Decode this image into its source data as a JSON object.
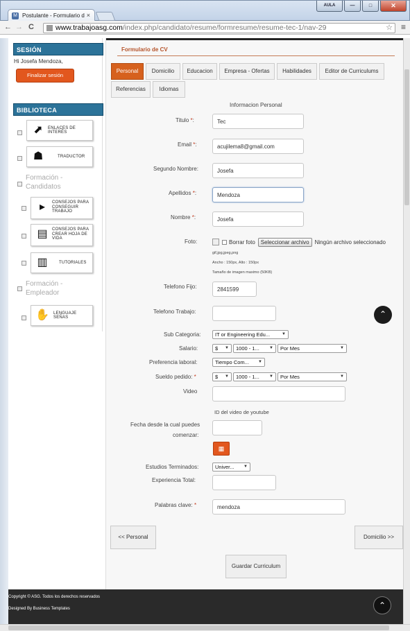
{
  "browser": {
    "tab_title": "Postulante - Formulario d",
    "tab_close": "×",
    "window_buttons": {
      "user": "AULA",
      "minimize": "—",
      "maximize": "□",
      "close": "✕"
    },
    "url_host": "www.trabajoasg.com",
    "url_path": "/index.php/candidato/resume/formresume/resume-tec-1/nav-29",
    "nav_back": "←",
    "nav_forward": "→",
    "nav_reload": "C",
    "star": "☆",
    "menu": "≡"
  },
  "sidebar": {
    "session_title": "SESIÓN",
    "greeting": "Hi Josefa Mendoza,",
    "logout_label": "Finalizar sesión",
    "library_title": "BIBLIOTECA",
    "items": [
      {
        "label": "ENLACES DE INTERÉS",
        "icon": "external-link-icon"
      },
      {
        "label": "TRADUCTOR",
        "icon": "translator-icon"
      },
      {
        "label": "CONSEJOS PARA CONSEGUIR TRABAJO",
        "icon": "presenter-icon"
      },
      {
        "label": "CONSEJOS PARA CREAR HOJA DE VIDA",
        "icon": "checklist-icon"
      },
      {
        "label": "TUTORIALES",
        "icon": "books-icon"
      },
      {
        "label": "LENGUAJE SEÑAS",
        "icon": "sign-language-icon"
      }
    ],
    "cat_candidates": "Formación - Candidatos",
    "cat_employer": "Formación - Empleador"
  },
  "form": {
    "title": "Formulario de CV",
    "tabs": [
      "Personal",
      "Domicilio",
      "Educacion",
      "Empresa - Ofertas",
      "Habilidades",
      "Editor de Curriculums",
      "Referencias",
      "Idiomas"
    ],
    "section_heading": "Informacion Personal",
    "fields": {
      "titulo": {
        "label": "Titulo",
        "value": "Tec"
      },
      "email": {
        "label": "Email",
        "value": "acujilema8@gmail.com"
      },
      "segundo_nombre": {
        "label": "Segundo Nombre:",
        "value": "Josefa"
      },
      "apellidos": {
        "label": "Apellidos",
        "value": "Mendoza"
      },
      "nombre": {
        "label": "Nombre",
        "value": "Josefa"
      },
      "foto": {
        "label": "Foto:",
        "delete_label": "Borrar foto",
        "button_label": "Seleccionar archivo",
        "status": "Ningún archivo seleccionado",
        "formats": "gif,jpg,jpeg,png",
        "size": "Ancho : 150px, Alto : 150px",
        "max_size": "Tamaño de imagen maximo (50KB)"
      },
      "telefono_fijo": {
        "label": "Telefono Fijo:",
        "value": "2841599"
      },
      "telefono_trabajo": {
        "label": "Telefono Trabajo:",
        "value": ""
      },
      "sub_categoria": {
        "label": "Sub Categoria:",
        "value": "IT or Engineering Edu..."
      },
      "salario": {
        "label": "Salario:",
        "currency": "$",
        "range": "1000 - 1...",
        "period": "Por Mes"
      },
      "preferencia": {
        "label": "Preferencia laboral:",
        "value": "Tiempo Com..."
      },
      "sueldo": {
        "label": "Sueldo pedido:",
        "currency": "$",
        "range": "1000 - 1...",
        "period": "Por Mes"
      },
      "video": {
        "label": "Video",
        "value": "",
        "hint": "ID del video de youtube"
      },
      "fecha": {
        "label_line1": "Fecha desde la cual puedes",
        "label_line2": "comenzar:",
        "value": ""
      },
      "estudios": {
        "label": "Estudios Terminados:",
        "value": "Univer..."
      },
      "experiencia": {
        "label": "Experiencia Total:",
        "value": ""
      },
      "palabras": {
        "label": "Palabras clave:",
        "value": "mendoza"
      }
    },
    "req_mark": "*",
    "prev_label": "<< Personal",
    "next_label": "Domicilio >>",
    "save_label": "Guardar Curriculum",
    "calendar_icon": "▦",
    "caret": "▼"
  },
  "footer": {
    "copyright": "Copyright © ASG. Todos los derechos reservados",
    "designed_by": "Designed By Business Templates"
  },
  "scroll_up_glyph": "⌃"
}
